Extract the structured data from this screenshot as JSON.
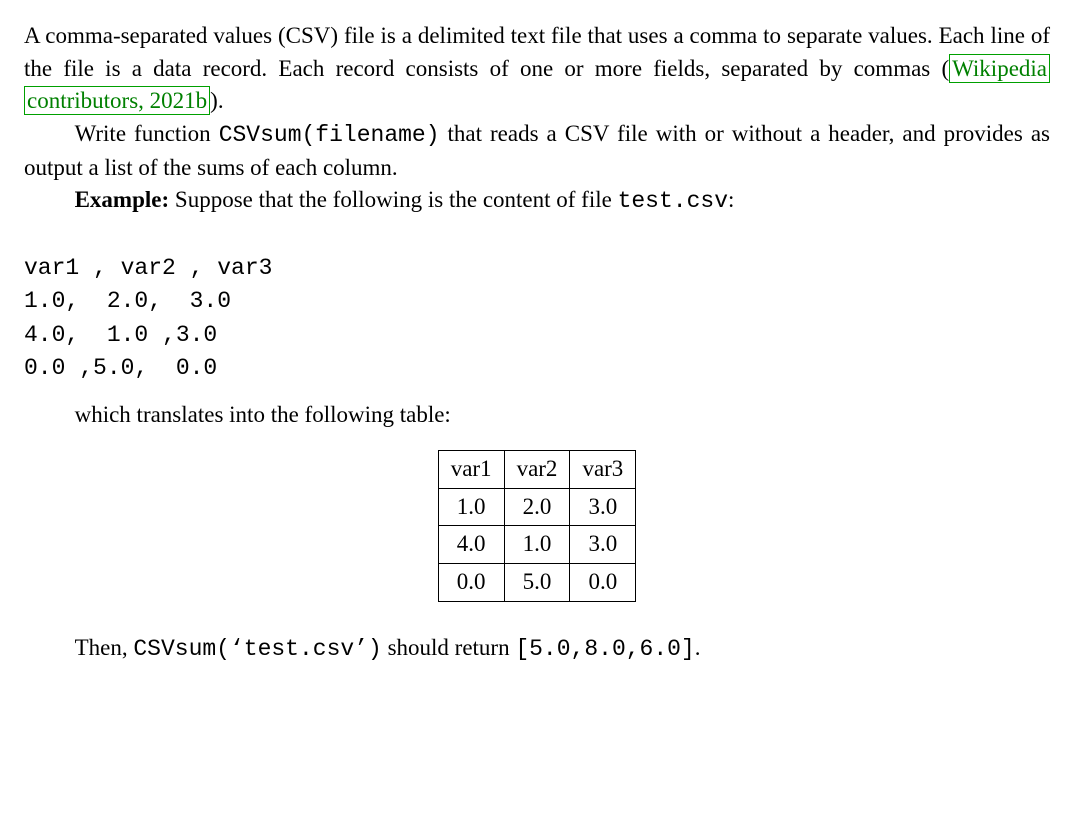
{
  "paragraphs": {
    "intro_before_cite": "A comma-separated values (CSV) file is a delimited text file that uses a comma to separate values. Each line of the file is a data record. Each record consists of one or more fields, separated by commas (",
    "cite_text": "Wikipedia contributors, 2021b",
    "intro_after_cite": ").",
    "task_pre": "Write function ",
    "task_code": "CSVsum(filename)",
    "task_post": " that reads a CSV file with or without a header, and provides as output a list of the sums of each column.",
    "example_label": "Example:",
    "example_rest": " Suppose that the following is the content of file ",
    "example_file": "test.csv",
    "example_tail": ":",
    "translates": "which translates into the following table:",
    "then_pre": "Then, ",
    "then_code": "CSVsum(‘test.csv’)",
    "then_mid": " should return ",
    "then_result": "[5.0,8.0,6.0]",
    "then_tail": "."
  },
  "csv_content": "var1 , var2 , var3\n1.0,  2.0,  3.0\n4.0,  1.0 ,3.0\n0.0 ,5.0,  0.0",
  "chart_data": {
    "type": "table",
    "columns": [
      "var1",
      "var2",
      "var3"
    ],
    "rows": [
      [
        "1.0",
        "2.0",
        "3.0"
      ],
      [
        "4.0",
        "1.0",
        "3.0"
      ],
      [
        "0.0",
        "5.0",
        "0.0"
      ]
    ]
  }
}
